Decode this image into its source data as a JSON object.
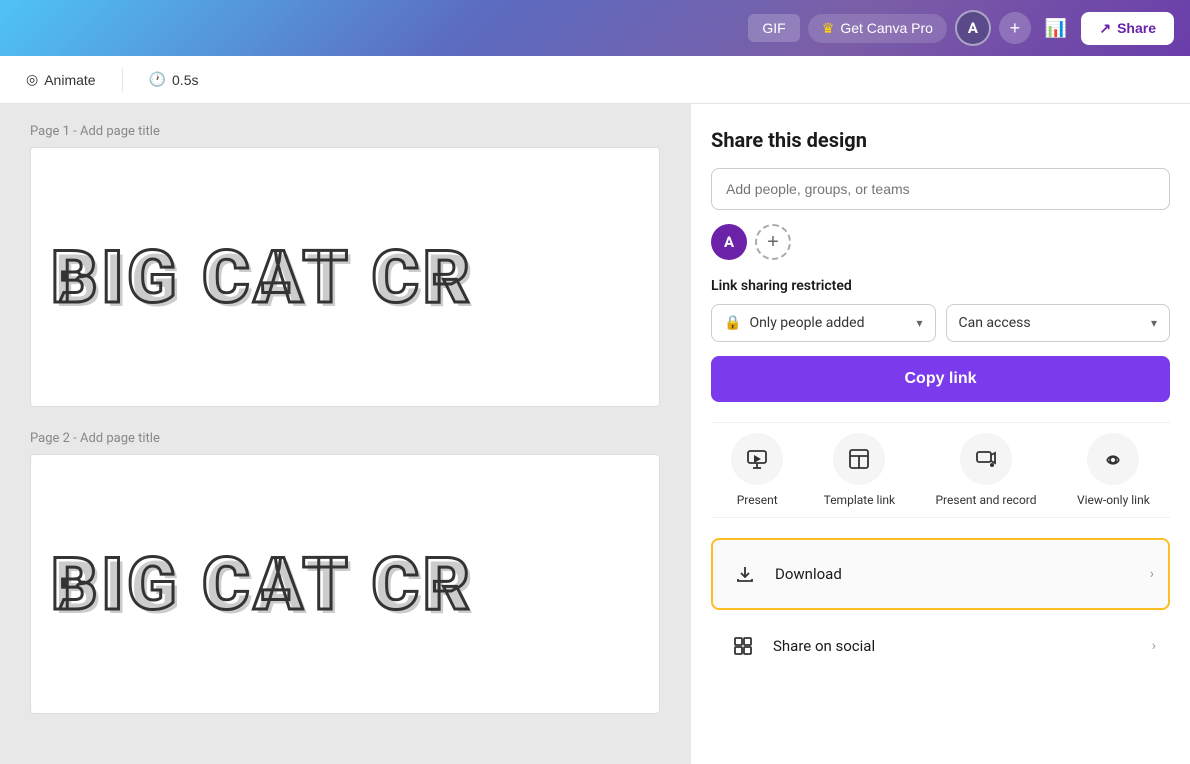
{
  "navbar": {
    "gif_label": "GIF",
    "canva_pro_label": "Get Canva Pro",
    "avatar_letter": "A",
    "share_label": "Share"
  },
  "subtoolbar": {
    "animate_label": "Animate",
    "duration_label": "0.5s"
  },
  "canvas": {
    "page1_label": "Page 1 -",
    "page1_placeholder": "Add page title",
    "page2_label": "Page 2 -",
    "page2_placeholder": "Add page title",
    "page1_text": "BIG CAT CR",
    "page2_text": "BIG CAT CR"
  },
  "share_panel": {
    "title": "Share this design",
    "input_placeholder": "Add people, groups, or teams",
    "avatar_letter": "A",
    "link_sharing_label": "Link sharing restricted",
    "dropdown1_text": "Only people added",
    "dropdown2_text": "Can access",
    "copy_link_label": "Copy link"
  },
  "actions": {
    "present_label": "Present",
    "template_link_label": "Template link",
    "present_record_label": "Present and record",
    "view_only_label": "View-only link"
  },
  "list_items": [
    {
      "id": "download",
      "label": "Download",
      "icon": "⬇"
    },
    {
      "id": "share-social",
      "label": "Share on social",
      "icon": "⊞"
    }
  ]
}
